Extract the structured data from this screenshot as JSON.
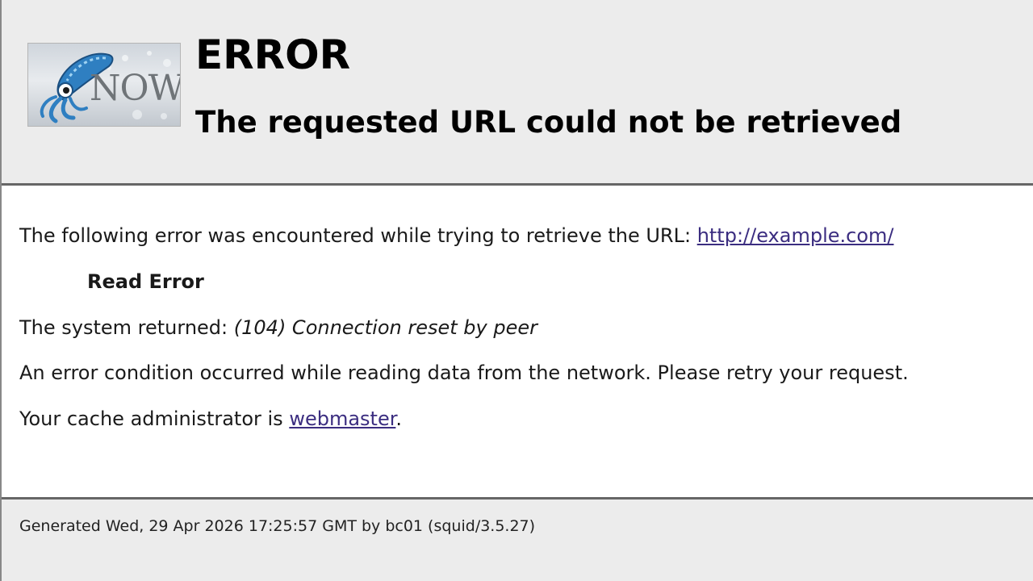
{
  "header": {
    "logo_text": "NOW",
    "title": "ERROR",
    "subtitle": "The requested URL could not be retrieved"
  },
  "content": {
    "intro_text": "The following error was encountered while trying to retrieve the URL: ",
    "url_link": "http://example.com/",
    "error_name": "Read Error",
    "system_prefix": "The system returned: ",
    "system_error": "(104) Connection reset by peer",
    "description": "An error condition occurred while reading data from the network. Please retry your request.",
    "admin_prefix": "Your cache administrator is ",
    "admin_link": "webmaster",
    "admin_suffix": "."
  },
  "footer": {
    "generated_text": "Generated Wed, 29 Apr 2026 17:25:57 GMT by bc01 (squid/3.5.27)"
  },
  "colors": {
    "link": "#3b2d80",
    "header_bg": "#ececec",
    "divider": "#666666"
  }
}
